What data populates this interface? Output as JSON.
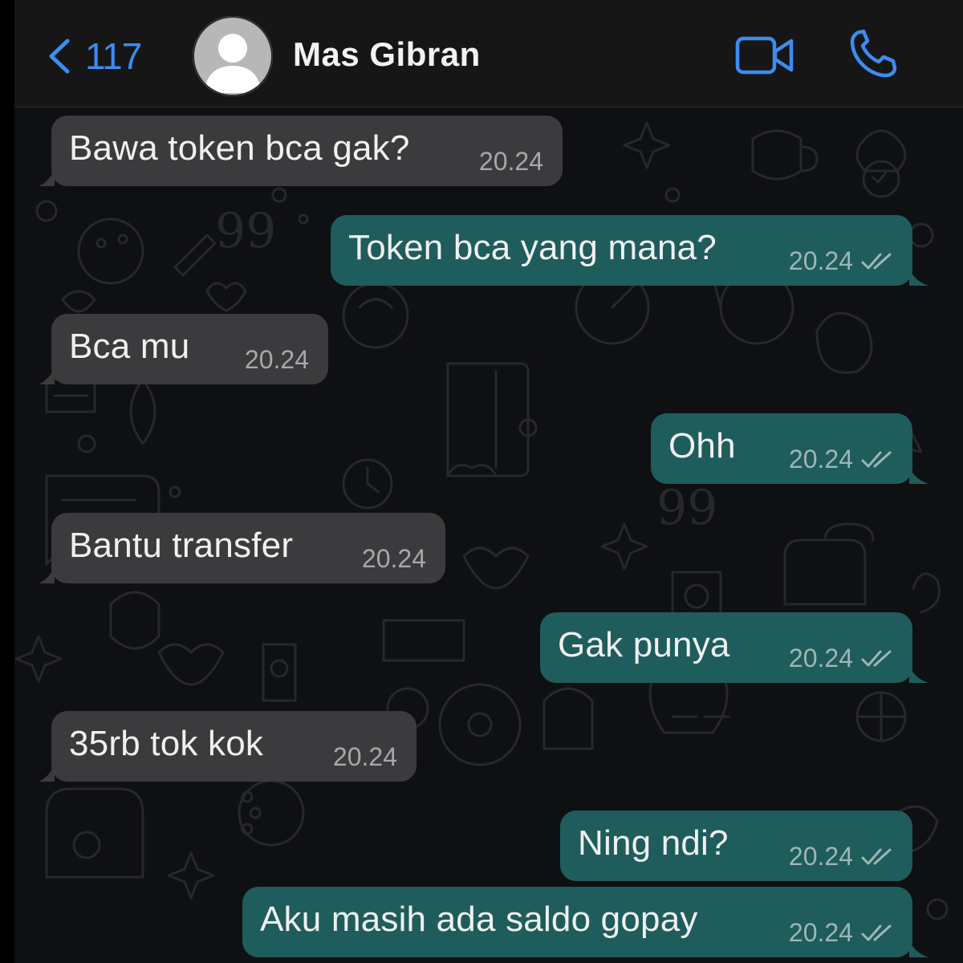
{
  "header": {
    "back_count": "117",
    "contact_name": "Mas Gibran",
    "accent_color": "#3d8cf0"
  },
  "icons": {
    "back": "chevron-left-icon",
    "avatar": "default-avatar-icon",
    "video": "video-camera-icon",
    "call": "phone-icon",
    "read_receipt": "double-check-icon"
  },
  "colors": {
    "incoming_bubble": "#3b3b3d",
    "outgoing_bubble": "#1f5c5c",
    "chat_background": "#0f1012"
  },
  "messages": [
    {
      "direction": "incoming",
      "text": "Bawa token bca gak?",
      "time": "20.24"
    },
    {
      "direction": "outgoing",
      "text": "Token bca yang mana?",
      "time": "20.24",
      "read": true
    },
    {
      "direction": "incoming",
      "text": "Bca mu",
      "time": "20.24"
    },
    {
      "direction": "outgoing",
      "text": "Ohh",
      "time": "20.24",
      "read": true
    },
    {
      "direction": "incoming",
      "text": "Bantu transfer",
      "time": "20.24"
    },
    {
      "direction": "outgoing",
      "text": "Gak punya",
      "time": "20.24",
      "read": true
    },
    {
      "direction": "incoming",
      "text": "35rb tok kok",
      "time": "20.24"
    },
    {
      "direction": "outgoing",
      "text": "Ning ndi?",
      "time": "20.24",
      "read": true
    },
    {
      "direction": "outgoing",
      "text": "Aku masih ada saldo gopay",
      "time": "20.24",
      "read": true
    }
  ]
}
